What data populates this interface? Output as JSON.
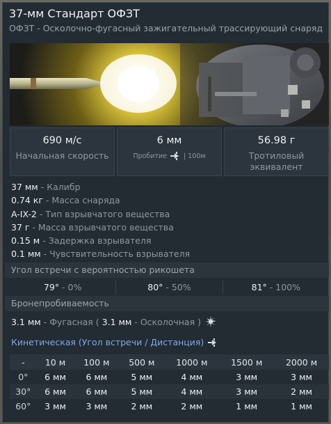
{
  "header": {
    "title": "37-мм Стандарт ОФЗТ",
    "subtitle": "ОФЗТ - Осколочно-фугасный зажигательный трассирующий снаряд"
  },
  "stats": {
    "velocity_value": "690 м/с",
    "velocity_label": "Начальная скорость",
    "penetration_value": "6 мм",
    "penetration_label": "Пробитие",
    "penetration_distance": "| 100м",
    "tnt_value": "56.98 г",
    "tnt_label": "Тротиловый эквивалент"
  },
  "properties": [
    {
      "value": "37 мм",
      "label": "Калибр"
    },
    {
      "value": "0.74 кг",
      "label": "Масса снаряда"
    },
    {
      "value": "A-IX-2",
      "label": "Тип взрывчатого вещества"
    },
    {
      "value": "37 г",
      "label": "Масса взрывчатого вещества"
    },
    {
      "value": "0.15 м",
      "label": "Задержка взрывателя"
    },
    {
      "value": "0.1 мм",
      "label": "Чувствительность взрывателя"
    }
  ],
  "ricochet": {
    "header": "Угол встречи с вероятностью рикошета",
    "entries": [
      {
        "angle": "79°",
        "prob": "0%"
      },
      {
        "angle": "80°",
        "prob": "50%"
      },
      {
        "angle": "81°",
        "prob": "100%"
      }
    ]
  },
  "penetration": {
    "header": "Бронепробиваемость",
    "he_value": "3.1 мм",
    "he_label": "Фугасная",
    "frag_value": "3.1 мм",
    "frag_label": "Осколочная"
  },
  "kinetic": {
    "title": "Кинетическая (Угол встречи / Дистанция)",
    "corner": "-",
    "columns": [
      "10 м",
      "100 м",
      "500 м",
      "1000 м",
      "1500 м",
      "2000 м"
    ],
    "rows": [
      {
        "angle": "0°",
        "values": [
          "6 мм",
          "6 мм",
          "5 мм",
          "4 мм",
          "3 мм",
          "3 мм"
        ]
      },
      {
        "angle": "30°",
        "values": [
          "6 мм",
          "6 мм",
          "5 мм",
          "4 мм",
          "3 мм",
          "2 мм"
        ]
      },
      {
        "angle": "60°",
        "values": [
          "3 мм",
          "3 мм",
          "2 мм",
          "2 мм",
          "1 мм",
          "1 мм"
        ]
      }
    ]
  },
  "icons": {
    "penetration": "shell-arrow-icon",
    "explosion": "explosion-icon",
    "kinetic": "shell-arrow-icon"
  }
}
